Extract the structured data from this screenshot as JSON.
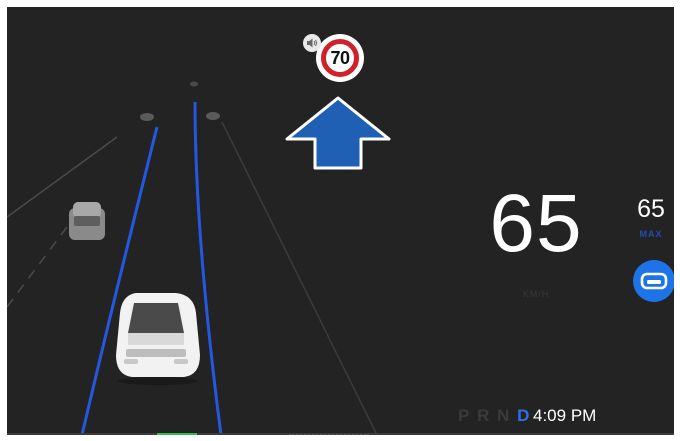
{
  "speed_limit_sign": {
    "value": "70"
  },
  "current_speed": {
    "value": "65",
    "unit": "KM/H"
  },
  "set_speed": {
    "value": "65",
    "label": "MAX"
  },
  "gear_selector": {
    "gears": [
      "P",
      "R",
      "N",
      "D"
    ],
    "active": "D"
  },
  "clock": {
    "time": "4:09",
    "period": "PM"
  },
  "navigation": {
    "direction": "straight-ahead"
  },
  "icons": {
    "speaker": "speaker-icon",
    "autopilot": "steering-wheel-icon",
    "nav_arrow": "arrow-up-icon"
  },
  "colors": {
    "background": "#232323",
    "lane_line": "#2458e0",
    "nav_arrow": "#1f5fb4",
    "autopilot_button": "#1e73e8",
    "active_gear": "#2e6fe8",
    "sign_ring": "#d0202a",
    "progress_fill": "#2ec04a"
  }
}
